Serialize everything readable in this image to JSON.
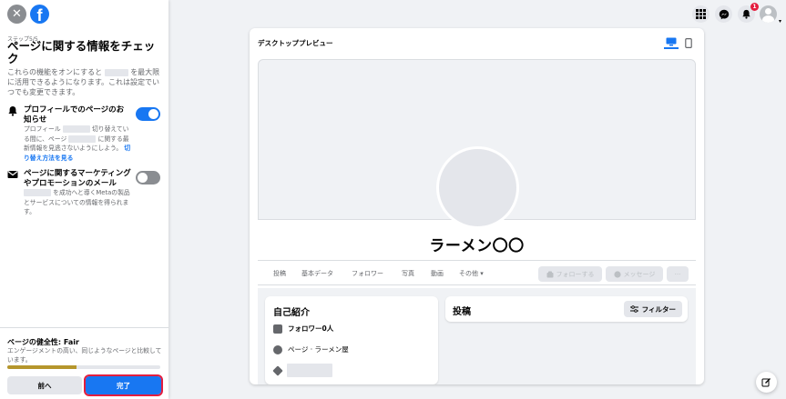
{
  "sidebar": {
    "close_glyph": "✕",
    "logo_glyph": "f",
    "step": "ステップ5/5",
    "title": "ページに関する情報をチェック",
    "intro_part1": "これらの機能をオンにすると",
    "intro_part2": "を最大限に活用できるようになります。これは設定でいつでも変更できます。",
    "settings": [
      {
        "icon": "bell-icon",
        "title": "プロフィールでのページのお知らせ",
        "desc_part1": "プロフィール",
        "desc_part2": "切り替えている間に、ページ",
        "desc_part3": "に関する最新情報を見逃さないようにしよう。",
        "link": "切り替え方法を見る",
        "enabled": true
      },
      {
        "icon": "envelope-icon",
        "title": "ページに関するマーケティングやプロモーションのメール",
        "desc": "を成功へと導くMetaの製品とサービスについての情報を得られます。",
        "enabled": false
      }
    ],
    "health_title": "ページの健全性: Fair",
    "health_desc": "エンゲージメントの高い、同じようなページと比較しています。",
    "health_progress": 0.45,
    "back_label": "前へ",
    "done_label": "完了"
  },
  "topbar": {
    "icons": [
      "grid-menu-icon",
      "messenger-icon",
      "notifications-icon",
      "account-icon"
    ],
    "notification_count": "1"
  },
  "preview": {
    "title": "デスクトッププレビュー",
    "active_device": "desktop",
    "page_name": "ラーメン〇〇",
    "tabs": [
      "投稿",
      "基本データ",
      "フォロワー",
      "写真",
      "動画",
      "その他 ▾"
    ],
    "follow_label": "フォローする",
    "message_label": "メッセージ",
    "more_label": "···",
    "intro": {
      "heading": "自己紹介",
      "followers": "フォロワー0人",
      "page_type": "ページ · ラーメン屋"
    },
    "posts": {
      "heading": "投稿",
      "filter_label": "フィルター"
    }
  },
  "colors": {
    "brand": "#1877f2",
    "health_bar": "#b5962c",
    "badge": "#e41e3f"
  }
}
